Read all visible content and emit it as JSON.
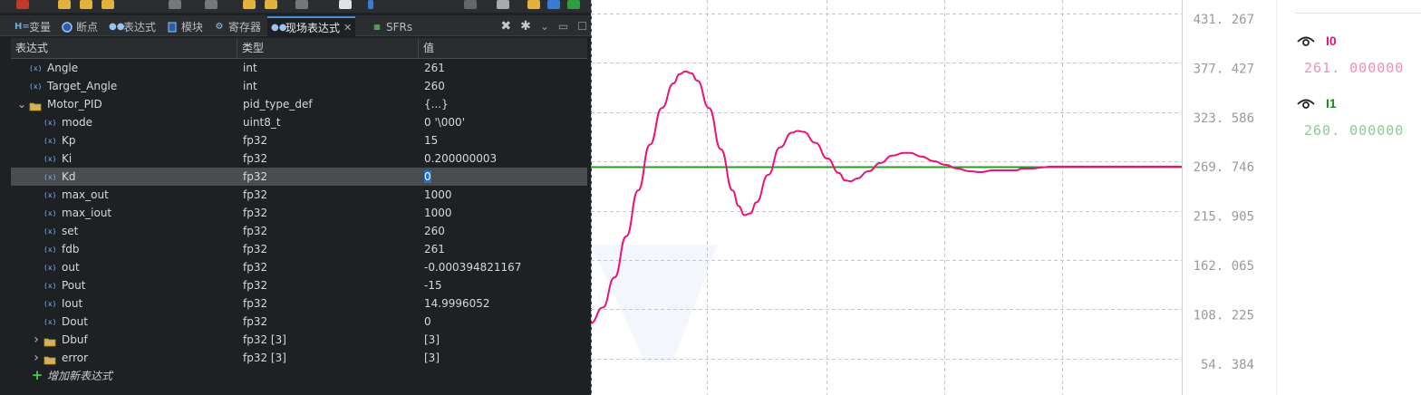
{
  "tabs": [
    {
      "label": "变量",
      "icon": "variables-icon"
    },
    {
      "label": "断点",
      "icon": "breakpoints-icon"
    },
    {
      "label": "表达式",
      "icon": "expressions-icon"
    },
    {
      "label": "模块",
      "icon": "modules-icon"
    },
    {
      "label": "寄存器",
      "icon": "registers-icon"
    },
    {
      "label": "现场表达式",
      "icon": "live-expressions-icon",
      "active": true
    },
    {
      "label": "SFRs",
      "icon": "sfrs-icon"
    }
  ],
  "columns": {
    "expression": "表达式",
    "type": "类型",
    "value": "值"
  },
  "rows": [
    {
      "name": "Angle",
      "type": "int",
      "value": "261",
      "depth": 0,
      "kind": "var"
    },
    {
      "name": "Target_Angle",
      "type": "int",
      "value": "260",
      "depth": 0,
      "kind": "var"
    },
    {
      "name": "Motor_PID",
      "type": "pid_type_def",
      "value": "{...}",
      "depth": 0,
      "kind": "struct",
      "expanded": true
    },
    {
      "name": "mode",
      "type": "uint8_t",
      "value": "0 '\\000'",
      "depth": 1,
      "kind": "var"
    },
    {
      "name": "Kp",
      "type": "fp32",
      "value": "15",
      "depth": 1,
      "kind": "var"
    },
    {
      "name": "Ki",
      "type": "fp32",
      "value": "0.200000003",
      "depth": 1,
      "kind": "var"
    },
    {
      "name": "Kd",
      "type": "fp32",
      "value": "0",
      "depth": 1,
      "kind": "var",
      "selected": true
    },
    {
      "name": "max_out",
      "type": "fp32",
      "value": "1000",
      "depth": 1,
      "kind": "var"
    },
    {
      "name": "max_iout",
      "type": "fp32",
      "value": "1000",
      "depth": 1,
      "kind": "var"
    },
    {
      "name": "set",
      "type": "fp32",
      "value": "260",
      "depth": 1,
      "kind": "var"
    },
    {
      "name": "fdb",
      "type": "fp32",
      "value": "261",
      "depth": 1,
      "kind": "var"
    },
    {
      "name": "out",
      "type": "fp32",
      "value": "-0.000394821167",
      "depth": 1,
      "kind": "var"
    },
    {
      "name": "Pout",
      "type": "fp32",
      "value": "-15",
      "depth": 1,
      "kind": "var"
    },
    {
      "name": "Iout",
      "type": "fp32",
      "value": "14.9996052",
      "depth": 1,
      "kind": "var"
    },
    {
      "name": "Dout",
      "type": "fp32",
      "value": "0",
      "depth": 1,
      "kind": "var"
    },
    {
      "name": "Dbuf",
      "type": "fp32 [3]",
      "value": "[3]",
      "depth": 1,
      "kind": "struct",
      "expanded": false
    },
    {
      "name": "error",
      "type": "fp32 [3]",
      "value": "[3]",
      "depth": 1,
      "kind": "struct",
      "expanded": false
    }
  ],
  "add_expression_label": "增加新表达式",
  "chart": {
    "y_ticks": [
      "431. 267",
      "377. 427",
      "323. 586",
      "269. 746",
      "215. 905",
      "162. 065",
      "108. 225",
      "54. 384"
    ],
    "y_tick_values": [
      431.267,
      377.427,
      323.586,
      269.746,
      215.905,
      162.065,
      108.225,
      54.384
    ],
    "grid": true,
    "series": [
      {
        "name": "I0",
        "color": "#ee1177",
        "current": "261. 000000",
        "value_color": "#f28fb5"
      },
      {
        "name": "I1",
        "color": "#1a8a1a",
        "current": "260. 000000",
        "value_color": "#8fca8f"
      }
    ],
    "line_color": "#ee1177",
    "target_color": "#2a9a2a"
  },
  "chart_data": {
    "type": "line",
    "ylim": [
      54.384,
      431.267
    ],
    "grid": true,
    "legend": "right",
    "series": [
      {
        "name": "I0",
        "points": [
          [
            0,
            100
          ],
          [
            2,
            117
          ],
          [
            4,
            150
          ],
          [
            6,
            195
          ],
          [
            8,
            245
          ],
          [
            10,
            295
          ],
          [
            12,
            335
          ],
          [
            14,
            362
          ],
          [
            15,
            372
          ],
          [
            16,
            375
          ],
          [
            17,
            373
          ],
          [
            18,
            365
          ],
          [
            20,
            335
          ],
          [
            22,
            290
          ],
          [
            24,
            245
          ],
          [
            25,
            228
          ],
          [
            26,
            218
          ],
          [
            27,
            220
          ],
          [
            28,
            232
          ],
          [
            30,
            262
          ],
          [
            32,
            292
          ],
          [
            34,
            308
          ],
          [
            35,
            310
          ],
          [
            36,
            309
          ],
          [
            38,
            297
          ],
          [
            40,
            280
          ],
          [
            42,
            264
          ],
          [
            43,
            256
          ],
          [
            44,
            255
          ],
          [
            45,
            258
          ],
          [
            47,
            266
          ],
          [
            49,
            275
          ],
          [
            51,
            283
          ],
          [
            53,
            286
          ],
          [
            54,
            286
          ],
          [
            56,
            282
          ],
          [
            58,
            277
          ],
          [
            60,
            273
          ],
          [
            62,
            269
          ],
          [
            64,
            266
          ],
          [
            66,
            265
          ],
          [
            68,
            267
          ],
          [
            70,
            267
          ],
          [
            72,
            267
          ],
          [
            73,
            269
          ],
          [
            75,
            269
          ],
          [
            76,
            270
          ],
          [
            78,
            271
          ],
          [
            100,
            271
          ]
        ]
      },
      {
        "name": "I1",
        "points": [
          [
            0,
            270.5
          ],
          [
            100,
            270.5
          ]
        ]
      }
    ]
  }
}
